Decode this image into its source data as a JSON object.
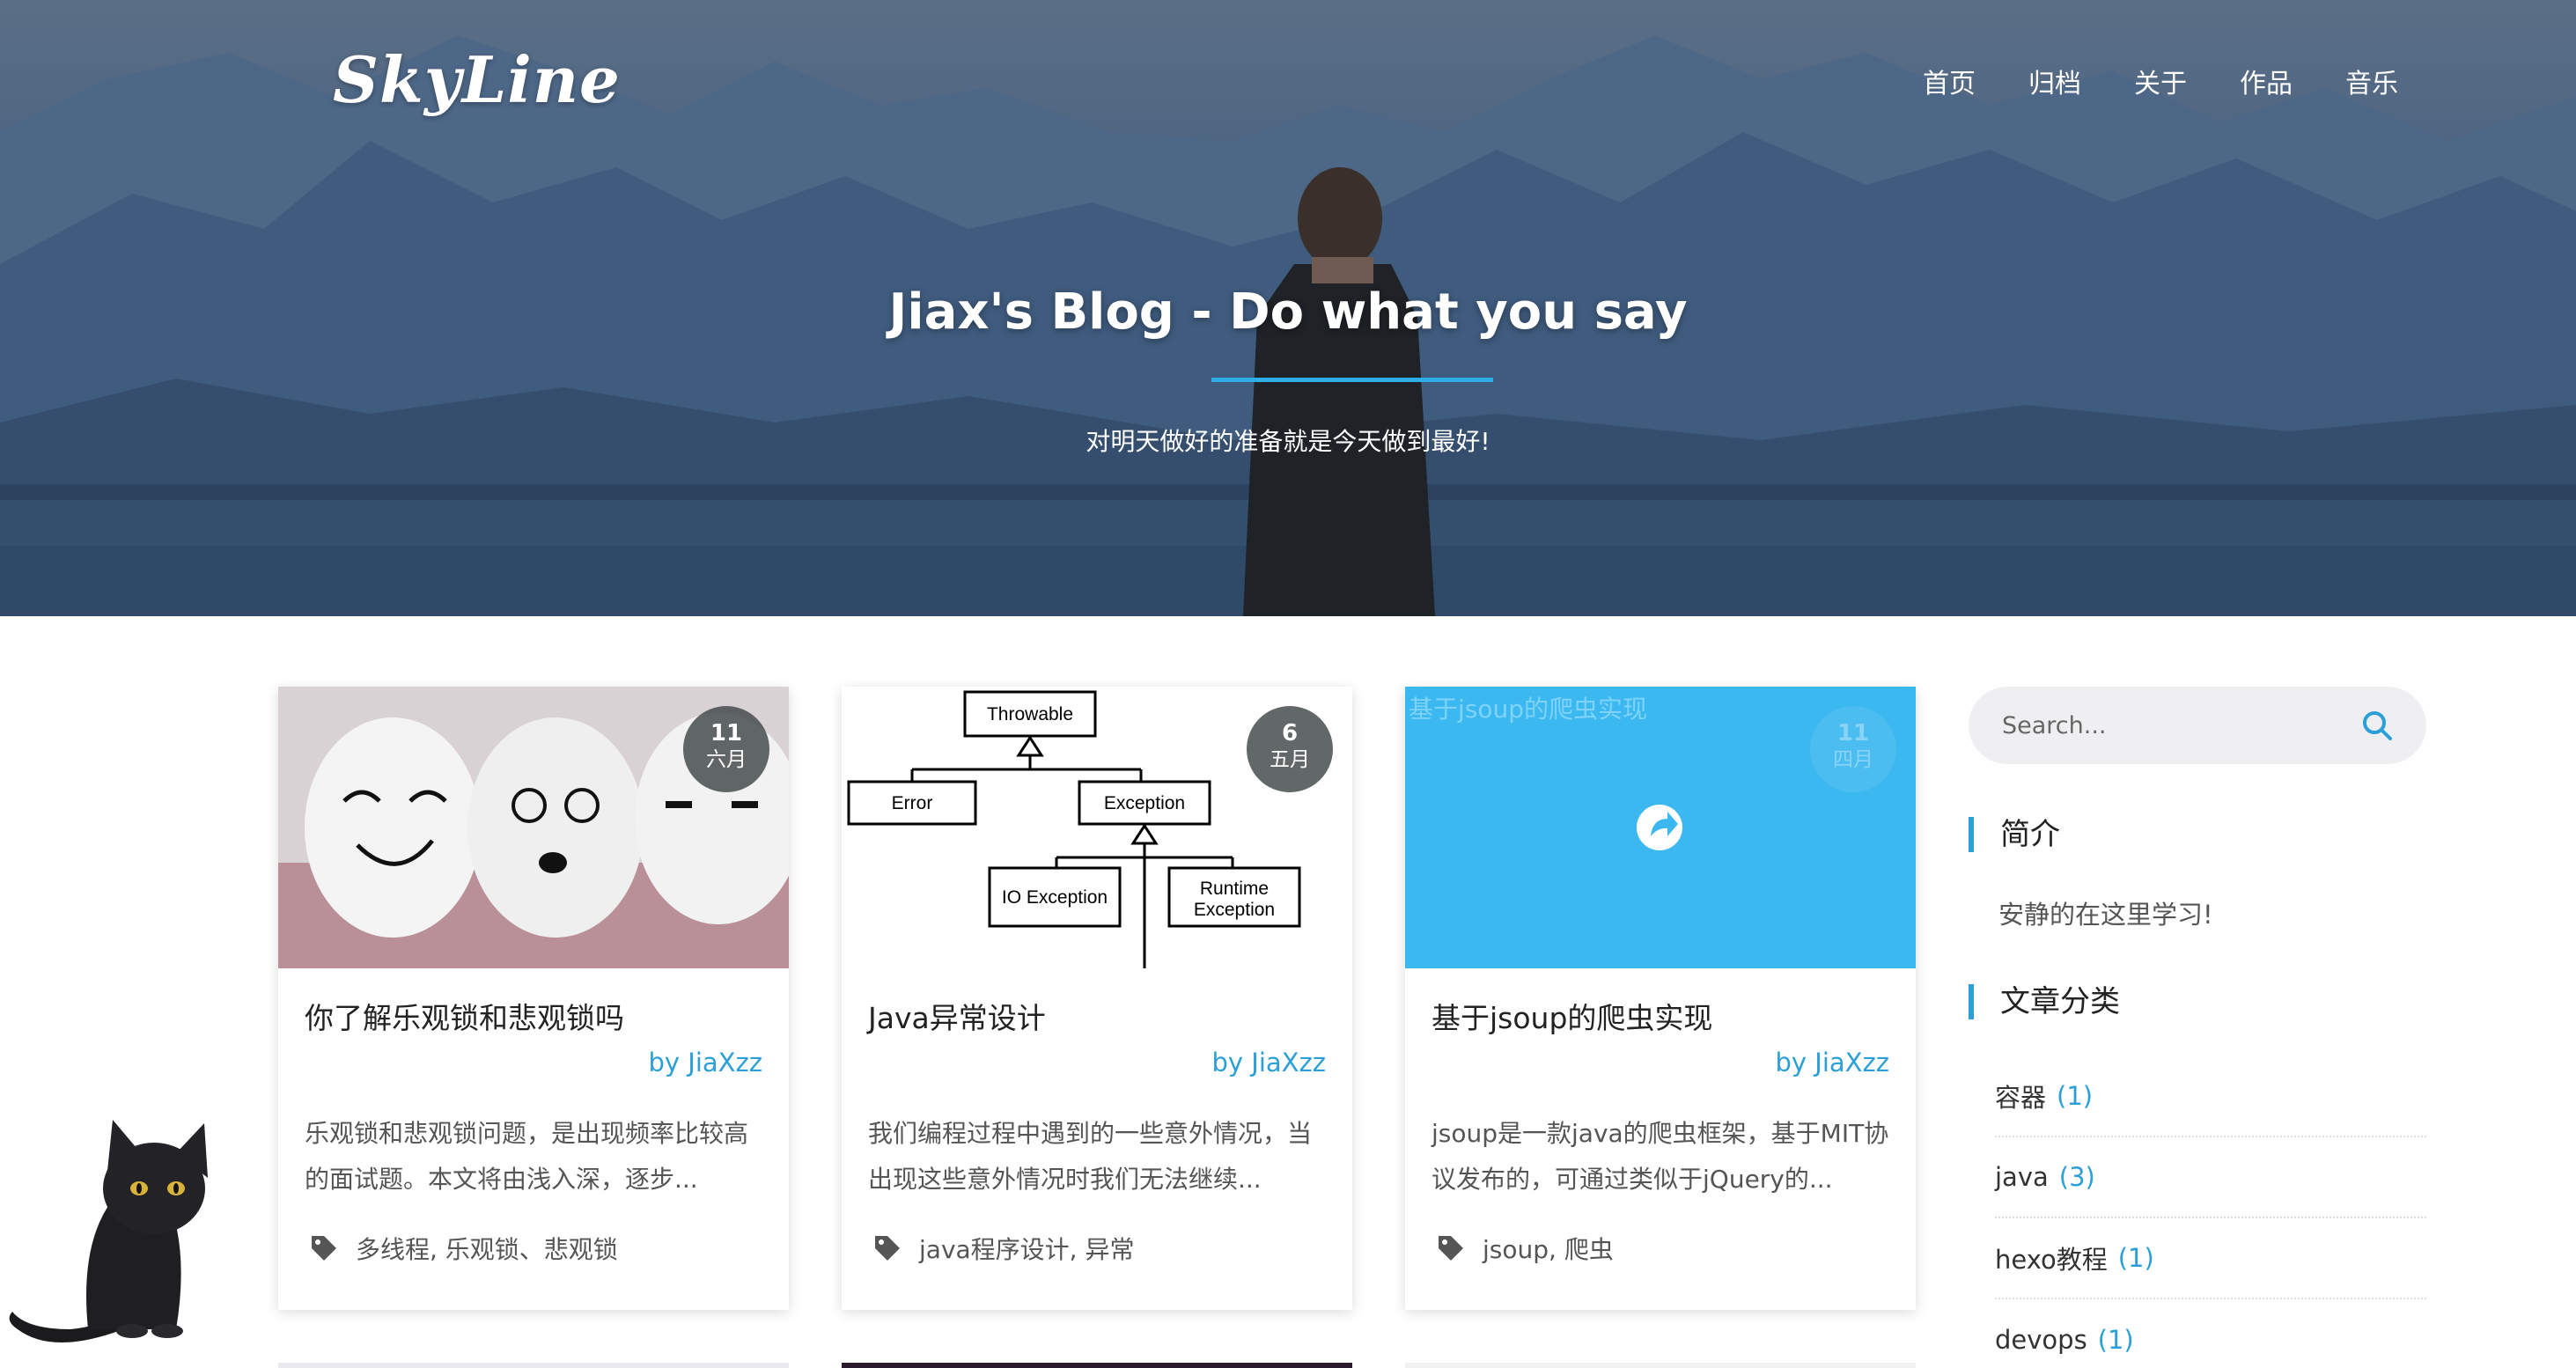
{
  "header": {
    "brand": "SkyLine",
    "nav": [
      "首页",
      "归档",
      "关于",
      "作品",
      "音乐"
    ]
  },
  "hero": {
    "title": "Jiax's Blog - Do what you say",
    "subtitle": "对明天做好的准备就是今天做到最好!"
  },
  "posts": [
    {
      "title": "你了解乐观锁和悲观锁吗",
      "author": "by JiaXzz",
      "excerpt": "乐观锁和悲观锁问题，是出现频率比较高的面试题。本文将由浅入深，逐步...",
      "day": "11",
      "month": "六月",
      "tags": "多线程, 乐观锁、悲观锁"
    },
    {
      "title": "Java异常设计",
      "author": "by JiaXzz",
      "excerpt": "我们编程过程中遇到的一些意外情况，当出现这些意外情况时我们无法继续...",
      "day": "6",
      "month": "五月",
      "tags": "java程序设计, 异常",
      "diagram": [
        "Throwable",
        "Error",
        "Exception",
        "IO Exception",
        "Runtime",
        "Exception"
      ]
    },
    {
      "title": "基于jsoup的爬虫实现",
      "author": "by JiaXzz",
      "excerpt": "jsoup是一款java的爬虫框架，基于MIT协议发布的，可通过类似于jQuery的...",
      "day": "11",
      "month": "四月",
      "tags": "jsoup, 爬虫",
      "img_alt": "基于jsoup的爬虫实现"
    }
  ],
  "sidebar": {
    "search_placeholder": "Search...",
    "intro_title": "简介",
    "intro_text": "安静的在这里学习!",
    "categories_title": "文章分类",
    "categories": [
      {
        "name": "容器",
        "count": "(1)"
      },
      {
        "name": "java",
        "count": "(3)"
      },
      {
        "name": "hexo教程",
        "count": "(1)"
      },
      {
        "name": "devops",
        "count": "(1)"
      }
    ]
  },
  "colors": {
    "accent": "#2b9fd8",
    "hero_rule": "#2eaee8",
    "placeholder_blue": "#3cb8f0"
  },
  "icons": [
    "search-icon",
    "tag-icon",
    "share-icon",
    "cat-mascot"
  ]
}
